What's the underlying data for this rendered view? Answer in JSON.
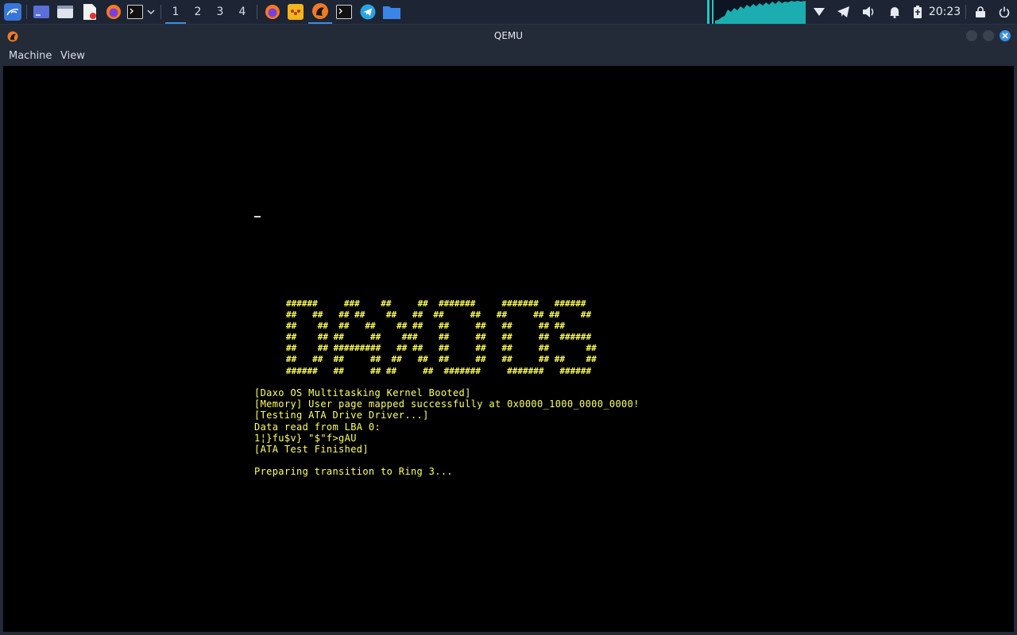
{
  "taskbar": {
    "workspaces": [
      "1",
      "2",
      "3",
      "4"
    ],
    "active_workspace": "1",
    "clock": "20:23",
    "launchers": [
      "kali-menu-icon",
      "show-desktop-icon",
      "file-manager-icon",
      "text-editor-icon",
      "firefox-icon",
      "terminal-icon",
      "dropdown-chevron-icon"
    ],
    "tasks": [
      "firefox-icon",
      "taskbar-app-icon",
      "qemu-icon",
      "terminal-icon",
      "telegram-icon",
      "folder-icon"
    ],
    "tray": [
      "network-icon",
      "telegram-tray-icon",
      "volume-icon",
      "notifications-icon",
      "battery-icon",
      "lock-icon",
      "power-icon"
    ],
    "accent": "#3b8fe0",
    "graph_color": "#1ec8c8"
  },
  "window": {
    "title": "QEMU",
    "menu": [
      "Machine",
      "View"
    ]
  },
  "vm": {
    "banner": [
      "######     ###    ##     ##  #######     #######   ######",
      "##   ##   ## ##    ##   ##  ##     ##   ##     ## ##    ##",
      "##    ##  ##   ##    ## ##   ##     ##   ##     ## ##",
      "##    ## ##     ##    ###    ##     ##   ##     ##  ######",
      "##    ## #########   ## ##   ##     ##   ##     ##       ##",
      "##   ##  ##     ##  ##   ##  ##     ##   ##     ## ##    ##",
      "######   ##     ## ##     ##  #######     #######   ######"
    ],
    "log": [
      "[Daxo OS Multitasking Kernel Booted]",
      "[Memory] User page mapped successfully at 0x0000_1000_0000_0000!",
      "[Testing ATA Drive Driver...]",
      "Data read from LBA 0:",
      "1¦}fu$v} \"$\"f>gAU",
      "[ATA Test Finished]",
      "",
      "Preparing transition to Ring 3..."
    ],
    "text_color": "#ffff55"
  }
}
